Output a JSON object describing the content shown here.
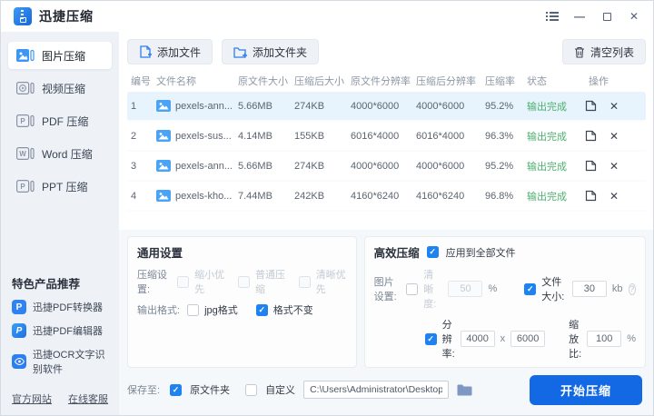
{
  "window": {
    "title": "迅捷压缩"
  },
  "icons": {
    "minimize": "—",
    "close": "✕",
    "delete_row": "✕",
    "help": "?"
  },
  "sidebar": {
    "items": [
      {
        "label": "图片压缩",
        "selected": true
      },
      {
        "label": "视频压缩",
        "selected": false
      },
      {
        "label": "PDF 压缩",
        "selected": false
      },
      {
        "label": "Word 压缩",
        "selected": false
      },
      {
        "label": "PPT 压缩",
        "selected": false
      }
    ],
    "products_title": "特色产品推荐",
    "products": [
      {
        "label": "迅捷PDF转换器",
        "icon_letter": "P"
      },
      {
        "label": "迅捷PDF编辑器",
        "icon_letter": "P"
      },
      {
        "label": "迅捷OCR文字识别软件"
      }
    ],
    "links": [
      {
        "label": "官方网站"
      },
      {
        "label": "在线客服"
      }
    ]
  },
  "toolbar": {
    "add_file": "添加文件",
    "add_folder": "添加文件夹",
    "clear_list": "清空列表"
  },
  "table": {
    "headers": [
      "编号",
      "文件名称",
      "原文件大小",
      "压缩后大小",
      "原文件分辨率",
      "压缩后分辨率",
      "压缩率",
      "状态",
      "操作"
    ],
    "rows": [
      {
        "no": "1",
        "name": "pexels-ann...",
        "orig_size": "5.66MB",
        "comp_size": "274KB",
        "orig_res": "4000*6000",
        "comp_res": "4000*6000",
        "rate": "95.2%",
        "status": "输出完成",
        "selected": true
      },
      {
        "no": "2",
        "name": "pexels-sus...",
        "orig_size": "4.14MB",
        "comp_size": "155KB",
        "orig_res": "6016*4000",
        "comp_res": "6016*4000",
        "rate": "96.3%",
        "status": "输出完成",
        "selected": false
      },
      {
        "no": "3",
        "name": "pexels-ann...",
        "orig_size": "5.66MB",
        "comp_size": "274KB",
        "orig_res": "4000*6000",
        "comp_res": "4000*6000",
        "rate": "95.2%",
        "status": "输出完成",
        "selected": false
      },
      {
        "no": "4",
        "name": "pexels-kho...",
        "orig_size": "7.44MB",
        "comp_size": "242KB",
        "orig_res": "4160*6240",
        "comp_res": "4160*6240",
        "rate": "96.8%",
        "status": "输出完成",
        "selected": false
      }
    ]
  },
  "general_settings": {
    "title": "通用设置",
    "compression_label": "压缩设置:",
    "options": [
      "缩小优先",
      "普通压缩",
      "清晰优先"
    ],
    "output_label": "输出格式:",
    "jpg_option": "jpg格式",
    "keep_option": "格式不变"
  },
  "efficient_settings": {
    "title": "高效压缩",
    "apply_all": "应用到全部文件",
    "image_label": "图片设置:",
    "clarity_label": "清晰度:",
    "clarity_value": "50",
    "clarity_unit": "%",
    "size_label": "文件大小:",
    "size_value": "30",
    "size_unit": "kb",
    "res_label": "分辨率:",
    "res_width": "4000",
    "res_sep": "x",
    "res_height": "6000",
    "scale_label": "缩放比:",
    "scale_value": "100",
    "scale_unit": "%"
  },
  "bottom": {
    "save_label": "保存至:",
    "orig_folder_option": "原文件夹",
    "custom_option": "自定义",
    "path": "C:\\Users\\Administrator\\Desktop",
    "start_button": "开始压缩"
  },
  "colors": {
    "accent": "#1269e3",
    "checkbox_blue": "#1e82f0",
    "status_green": "#4cb06d",
    "row_selected": "#e7f3fd",
    "sidebar_bg": "#eef2f7"
  }
}
